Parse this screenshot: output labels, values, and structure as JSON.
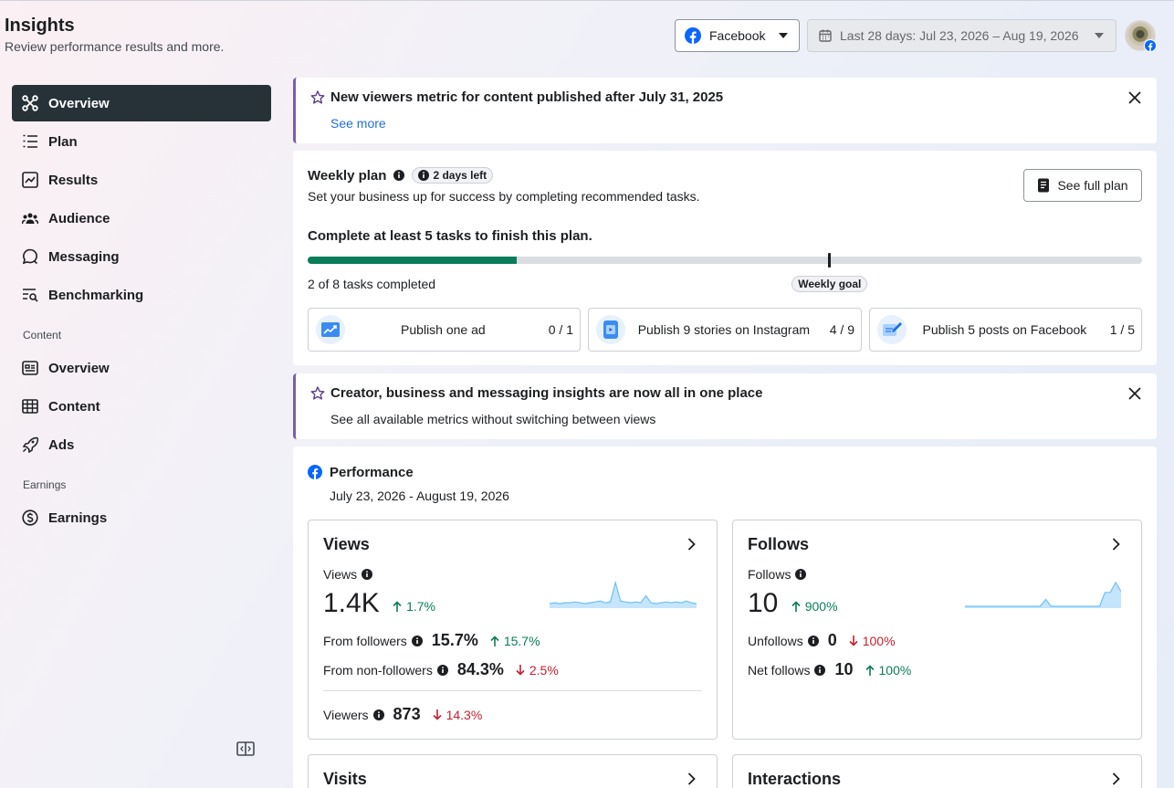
{
  "header": {
    "title": "Insights",
    "subtitle": "Review performance results and more.",
    "platform": "Facebook",
    "date_range": "Last 28 days: Jul 23, 2026 – Aug 19, 2026"
  },
  "sidebar": {
    "items": [
      {
        "label": "Overview",
        "icon": "overview-icon",
        "active": true
      },
      {
        "label": "Plan",
        "icon": "plan-icon"
      },
      {
        "label": "Results",
        "icon": "results-icon"
      },
      {
        "label": "Audience",
        "icon": "audience-icon"
      },
      {
        "label": "Messaging",
        "icon": "messaging-icon"
      },
      {
        "label": "Benchmarking",
        "icon": "benchmarking-icon"
      }
    ],
    "content_section": "Content",
    "content_items": [
      {
        "label": "Overview",
        "icon": "content-overview-icon"
      },
      {
        "label": "Content",
        "icon": "table-icon"
      },
      {
        "label": "Ads",
        "icon": "rocket-icon"
      }
    ],
    "earnings_section": "Earnings",
    "earnings_items": [
      {
        "label": "Earnings",
        "icon": "dollar-icon"
      }
    ]
  },
  "notice1": {
    "title": "New viewers metric for content published after July 31, 2025",
    "link": "See more"
  },
  "weekly_plan": {
    "title": "Weekly plan",
    "badge": "2 days left",
    "subtitle": "Set your business up for success by completing recommended tasks.",
    "button": "See full plan",
    "goal_text": "Complete at least 5 tasks to finish this plan.",
    "progress": 0.25,
    "goal_position": 0.625,
    "goal_label": "Weekly goal",
    "count_text": "2 of 8 tasks completed",
    "tasks": [
      {
        "label": "Publish one ad",
        "count": "0 / 1",
        "icon": "ad-chart-icon"
      },
      {
        "label": "Publish 9 stories on Instagram",
        "count": "4 / 9",
        "icon": "story-icon"
      },
      {
        "label": "Publish 5 posts on Facebook",
        "count": "1 / 5",
        "icon": "post-icon"
      }
    ]
  },
  "notice2": {
    "title": "Creator, business and messaging insights are now all in one place",
    "subtitle": "See all available metrics without switching between views"
  },
  "performance": {
    "title": "Performance",
    "date": "July 23, 2026 - August 19, 2026",
    "views": {
      "title": "Views",
      "label": "Views",
      "value": "1.4K",
      "change": "1.7%",
      "from_followers_label": "From followers",
      "from_followers_value": "15.7%",
      "from_followers_change": "15.7%",
      "from_nonfollowers_label": "From non-followers",
      "from_nonfollowers_value": "84.3%",
      "from_nonfollowers_change": "2.5%",
      "viewers_label": "Viewers",
      "viewers_value": "873",
      "viewers_change": "14.3%",
      "spark": [
        3,
        4,
        3,
        4,
        4,
        5,
        4,
        3,
        4,
        5,
        6,
        4,
        5,
        27,
        6,
        5,
        4,
        5,
        4,
        12,
        4,
        3,
        4,
        5,
        4,
        5,
        4,
        6,
        4,
        3
      ]
    },
    "follows": {
      "title": "Follows",
      "label": "Follows",
      "value": "10",
      "change": "900%",
      "unfollows_label": "Unfollows",
      "unfollows_value": "0",
      "unfollows_change": "100%",
      "net_label": "Net follows",
      "net_value": "10",
      "net_change": "100%",
      "spark": [
        0,
        0,
        0,
        0,
        0,
        0,
        0,
        0,
        0,
        0,
        0,
        0,
        0,
        0,
        0,
        7,
        0,
        0,
        0,
        0,
        0,
        0,
        0,
        0,
        0,
        0,
        14,
        14,
        24,
        15
      ]
    },
    "visits": {
      "title": "Visits"
    },
    "interactions": {
      "title": "Interactions"
    }
  },
  "colors": {
    "accent_green": "#0a7c59",
    "negative_red": "#c2212e",
    "link_blue": "#216fdb",
    "active_nav": "#263238",
    "notice_border": "#7b5ea7",
    "spark_fill": "#b6dffb"
  }
}
